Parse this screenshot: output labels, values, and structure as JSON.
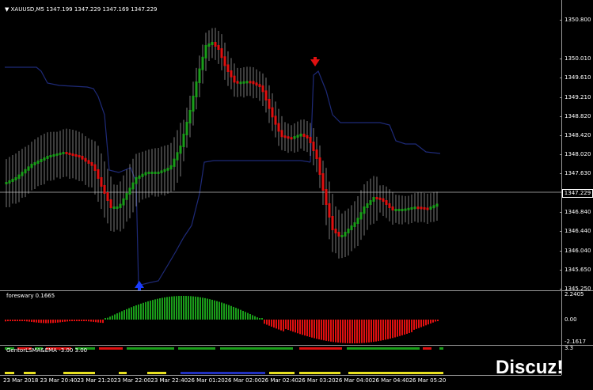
{
  "symbol_header": "▼ XAUUSD,M5  1347.199 1347.229 1347.169 1347.229",
  "current_price": "1347.229",
  "price_axis": [
    {
      "label": "1350.800",
      "value": 1350.8
    },
    {
      "label": "1350.010",
      "value": 1350.01
    },
    {
      "label": "1349.610",
      "value": 1349.61
    },
    {
      "label": "1349.210",
      "value": 1349.21
    },
    {
      "label": "1348.820",
      "value": 1348.82
    },
    {
      "label": "1348.420",
      "value": 1348.42
    },
    {
      "label": "1348.020",
      "value": 1348.02
    },
    {
      "label": "1347.630",
      "value": 1347.63
    },
    {
      "label": "1346.840",
      "value": 1346.84
    },
    {
      "label": "1346.440",
      "value": 1346.44
    },
    {
      "label": "1346.040",
      "value": 1346.04
    },
    {
      "label": "1345.650",
      "value": 1345.65
    },
    {
      "label": "1345.250",
      "value": 1345.25
    }
  ],
  "indicator1": {
    "title": "foreswary 0.1665",
    "axis": [
      {
        "label": "2.2405",
        "value": 2.2405
      },
      {
        "label": "0.00",
        "value": 0
      },
      {
        "label": "-2.1617",
        "value": -2.1617
      }
    ]
  },
  "indicator2": {
    "title": "GentorLSMA&EMA -3.00 3.00",
    "axis": [
      {
        "label": "3.3",
        "value": 3.3
      }
    ]
  },
  "time_axis": [
    "23 Mar 2018",
    "23 Mar 20:40",
    "23 Mar 21:20",
    "23 Mar 22:00",
    "23 Mar 22:40",
    "26 Mar 01:20",
    "26 Mar 02:00",
    "26 Mar 02:40",
    "26 Mar 03:20",
    "26 Mar 04:00",
    "26 Mar 04:40",
    "26 Mar 05:20"
  ],
  "colors": {
    "bull": "#1a9e1a",
    "bear": "#e01010",
    "wick": "#cccccc",
    "channel": "#1e2a78",
    "arrow_up": "#1a3cff",
    "arrow_down": "#e01010",
    "bar2_yellow": "#e8e020",
    "bar2_blue": "#2030c0"
  },
  "watermark": "Discuz!"
}
